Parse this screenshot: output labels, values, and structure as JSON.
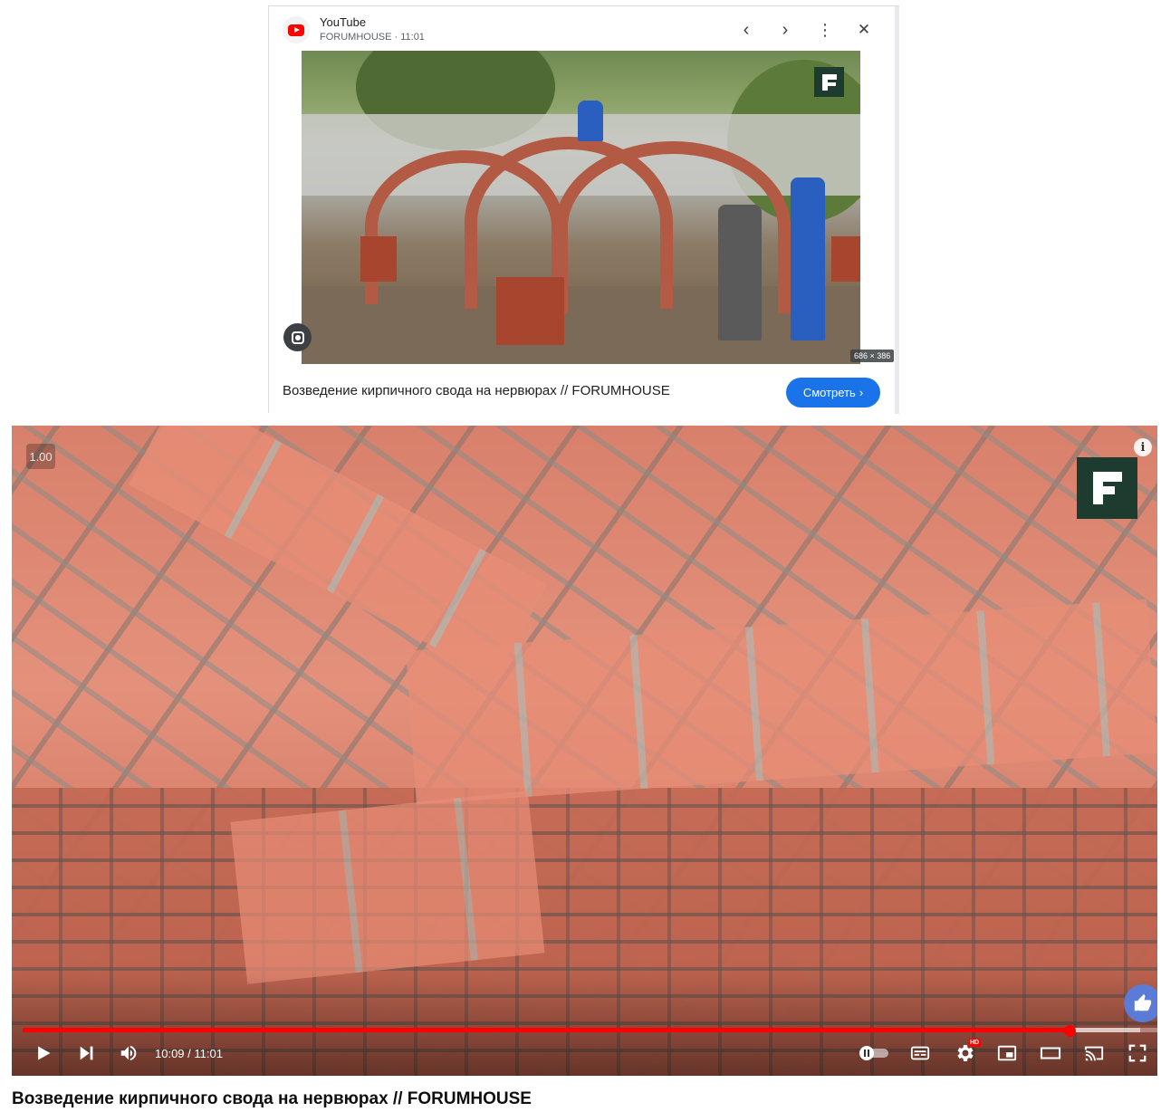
{
  "card": {
    "source_name": "YouTube",
    "source_meta": "FORUMHOUSE · 11:01",
    "image_dims": "686 × 386",
    "title": "Возведение кирпичного свода на нервюрах // FORUMHOUSE",
    "watch_label": "Смотреть",
    "watch_chevron": "›",
    "prev_glyph": "‹",
    "next_glyph": "›",
    "more_glyph": "⋮",
    "close_glyph": "✕"
  },
  "player": {
    "speed": "1.00",
    "info_glyph": "i",
    "time_text": "10:09 / 11:01",
    "progress_fraction": 0.9228,
    "buffer_fraction": 0.985,
    "hd_badge": "HD",
    "accent_color": "#ff0000"
  },
  "video": {
    "title": "Возведение кирпичного свода на нервюрах // FORUMHOUSE"
  }
}
